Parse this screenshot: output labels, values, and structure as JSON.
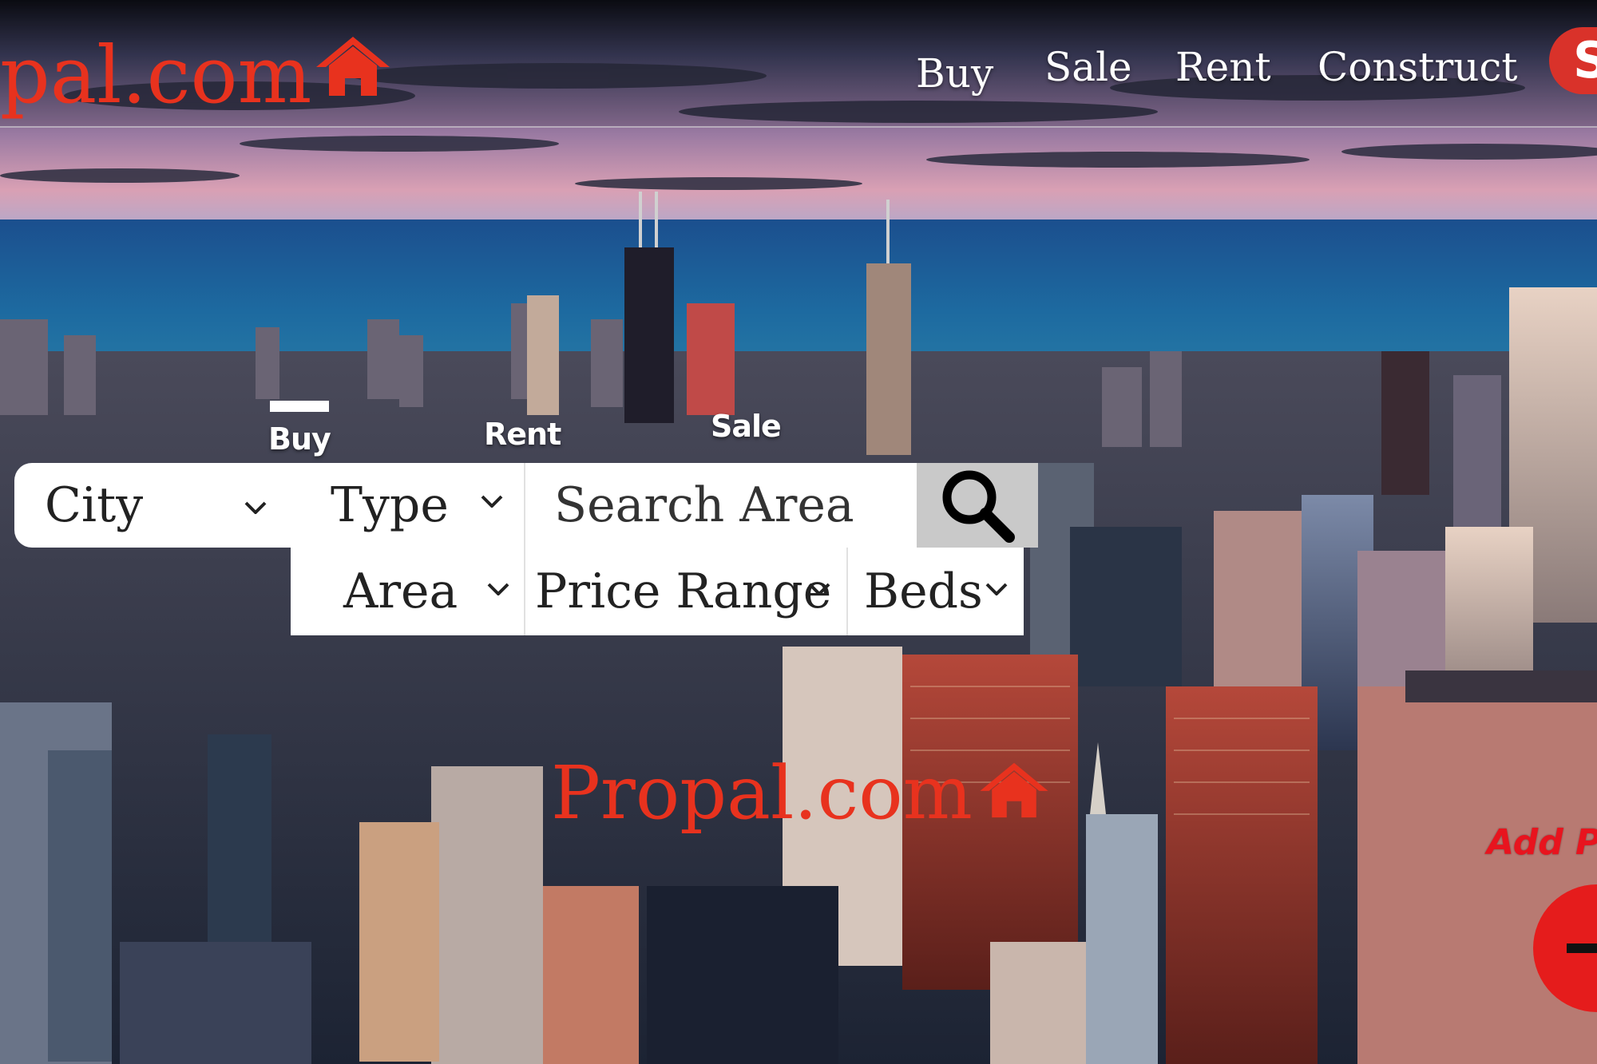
{
  "brand": {
    "logo_text": "pal.com",
    "center_logo_text": "Propal.com"
  },
  "nav": {
    "links": [
      "Buy",
      "Sale",
      "Rent",
      "Construct"
    ],
    "signin_label": "S"
  },
  "search": {
    "tabs": [
      "Buy",
      "Rent",
      "Sale"
    ],
    "active_tab": "Buy",
    "row1": {
      "city": "City",
      "type": "Type",
      "search_placeholder": "Search Area"
    },
    "row2": {
      "area": "Area",
      "price_range": "Price Range",
      "beds": "Beds"
    }
  },
  "add_property": {
    "label": "Add Pr"
  },
  "icons": {
    "logo": "house-icon",
    "search": "search-icon",
    "dropdown": "chevron-down-icon",
    "add": "minus-icon"
  },
  "colors": {
    "brand_red": "#e8321e",
    "search_button_bg": "#c9c9c9",
    "add_button": "#e51c1c"
  }
}
